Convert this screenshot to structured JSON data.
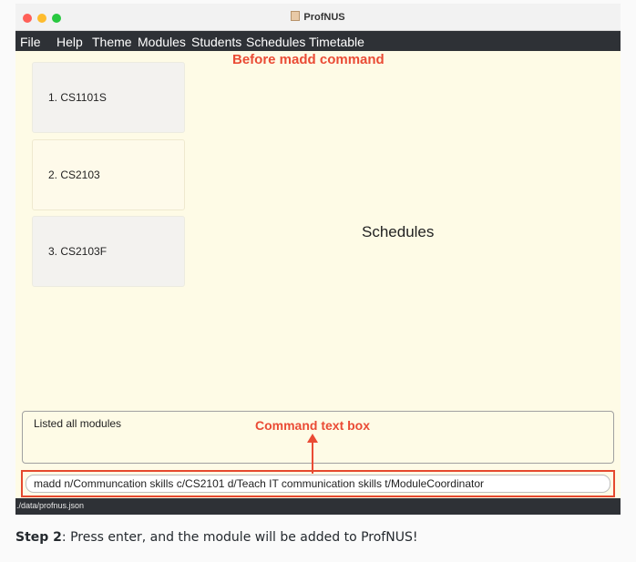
{
  "window": {
    "title": "ProfNUS"
  },
  "menu": [
    "File",
    "Help",
    "Theme",
    "Modules",
    "Students",
    "Schedules",
    "Timetable"
  ],
  "modules": [
    {
      "label": "1.  CS1101S"
    },
    {
      "label": "2.  CS2103"
    },
    {
      "label": "3.  CS2103F"
    }
  ],
  "schedules_panel": {
    "label": "Schedules"
  },
  "result": {
    "text": "Listed all modules"
  },
  "command": {
    "value": "madd n/Communcation skills c/CS2101 d/Teach IT communication skills t/ModuleCoordinator"
  },
  "status": {
    "path": "./data/profnus.json"
  },
  "annotations": {
    "before": "Before madd command",
    "command_box": "Command text box",
    "color": "#ea4b35"
  },
  "caption": {
    "step": "Step 2",
    "text": ": Press enter, and the module will be added to ProfNUS!"
  }
}
